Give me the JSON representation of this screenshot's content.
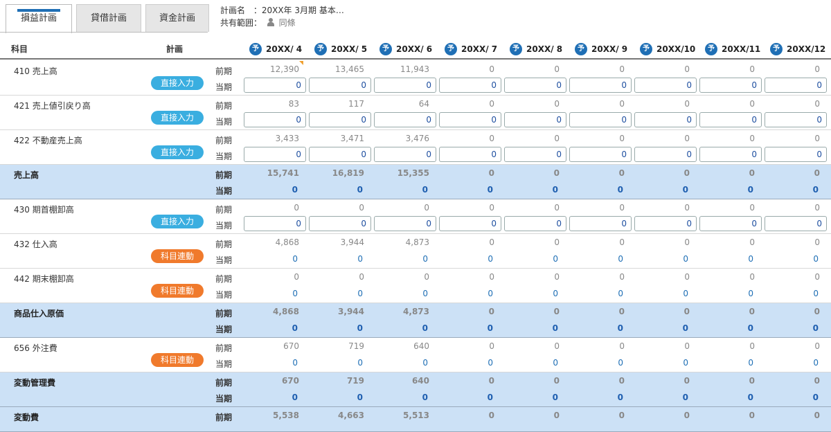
{
  "tabs": [
    {
      "label": "損益計画",
      "active": true
    },
    {
      "label": "貸借計画",
      "active": false
    },
    {
      "label": "資金計画",
      "active": false
    }
  ],
  "info": {
    "plan_name_label": "計画名",
    "plan_name_value": "：20XX年 3月期 基本…",
    "share_label": "共有範囲：",
    "share_value": "同條"
  },
  "headers": {
    "account": "科目",
    "plan": "計画",
    "forecast_mark": "予",
    "months": [
      "20XX/ 4",
      "20XX/ 5",
      "20XX/ 6",
      "20XX/ 7",
      "20XX/ 8",
      "20XX/ 9",
      "20XX/10",
      "20XX/11",
      "20XX/12"
    ]
  },
  "labels": {
    "prev": "前期",
    "cur": "当期"
  },
  "rows": [
    {
      "name": "410  売上高",
      "badge": "直接入力",
      "badge_type": "direct",
      "total": false,
      "input": true,
      "prev": [
        "12,390",
        "13,465",
        "11,943",
        "0",
        "0",
        "0",
        "0",
        "0",
        "0"
      ],
      "cur": [
        "0",
        "0",
        "0",
        "0",
        "0",
        "0",
        "0",
        "0",
        "0"
      ]
    },
    {
      "name": "421  売上値引戻り高",
      "badge": "直接入力",
      "badge_type": "direct",
      "total": false,
      "input": true,
      "prev": [
        "83",
        "117",
        "64",
        "0",
        "0",
        "0",
        "0",
        "0",
        "0"
      ],
      "cur": [
        "0",
        "0",
        "0",
        "0",
        "0",
        "0",
        "0",
        "0",
        "0"
      ]
    },
    {
      "name": "422  不動産売上高",
      "badge": "直接入力",
      "badge_type": "direct",
      "total": false,
      "input": true,
      "prev": [
        "3,433",
        "3,471",
        "3,476",
        "0",
        "0",
        "0",
        "0",
        "0",
        "0"
      ],
      "cur": [
        "0",
        "0",
        "0",
        "0",
        "0",
        "0",
        "0",
        "0",
        "0"
      ]
    },
    {
      "name": "売上高",
      "badge": "",
      "badge_type": "",
      "total": true,
      "input": false,
      "prev": [
        "15,741",
        "16,819",
        "15,355",
        "0",
        "0",
        "0",
        "0",
        "0",
        "0"
      ],
      "cur": [
        "0",
        "0",
        "0",
        "0",
        "0",
        "0",
        "0",
        "0",
        "0"
      ]
    },
    {
      "name": "430  期首棚卸高",
      "badge": "直接入力",
      "badge_type": "direct",
      "total": false,
      "input": true,
      "prev": [
        "0",
        "0",
        "0",
        "0",
        "0",
        "0",
        "0",
        "0",
        "0"
      ],
      "cur": [
        "0",
        "0",
        "0",
        "0",
        "0",
        "0",
        "0",
        "0",
        "0"
      ]
    },
    {
      "name": "432  仕入高",
      "badge": "科目連動",
      "badge_type": "link",
      "total": false,
      "input": false,
      "prev": [
        "4,868",
        "3,944",
        "4,873",
        "0",
        "0",
        "0",
        "0",
        "0",
        "0"
      ],
      "cur": [
        "0",
        "0",
        "0",
        "0",
        "0",
        "0",
        "0",
        "0",
        "0"
      ]
    },
    {
      "name": "442  期末棚卸高",
      "badge": "科目連動",
      "badge_type": "link",
      "total": false,
      "input": false,
      "prev": [
        "0",
        "0",
        "0",
        "0",
        "0",
        "0",
        "0",
        "0",
        "0"
      ],
      "cur": [
        "0",
        "0",
        "0",
        "0",
        "0",
        "0",
        "0",
        "0",
        "0"
      ]
    },
    {
      "name": "商品仕入原価",
      "badge": "",
      "badge_type": "",
      "total": true,
      "input": false,
      "prev": [
        "4,868",
        "3,944",
        "4,873",
        "0",
        "0",
        "0",
        "0",
        "0",
        "0"
      ],
      "cur": [
        "0",
        "0",
        "0",
        "0",
        "0",
        "0",
        "0",
        "0",
        "0"
      ]
    },
    {
      "name": "656  外注費",
      "badge": "科目連動",
      "badge_type": "link",
      "total": false,
      "input": false,
      "prev": [
        "670",
        "719",
        "640",
        "0",
        "0",
        "0",
        "0",
        "0",
        "0"
      ],
      "cur": [
        "0",
        "0",
        "0",
        "0",
        "0",
        "0",
        "0",
        "0",
        "0"
      ]
    },
    {
      "name": "変動管理費",
      "badge": "",
      "badge_type": "",
      "total": true,
      "input": false,
      "prev": [
        "670",
        "719",
        "640",
        "0",
        "0",
        "0",
        "0",
        "0",
        "0"
      ],
      "cur": [
        "0",
        "0",
        "0",
        "0",
        "0",
        "0",
        "0",
        "0",
        "0"
      ]
    },
    {
      "name": "変動費",
      "badge": "",
      "badge_type": "",
      "total": true,
      "input": false,
      "last": true,
      "prev": [
        "5,538",
        "4,663",
        "5,513",
        "0",
        "0",
        "0",
        "0",
        "0",
        "0"
      ],
      "cur": []
    }
  ]
}
